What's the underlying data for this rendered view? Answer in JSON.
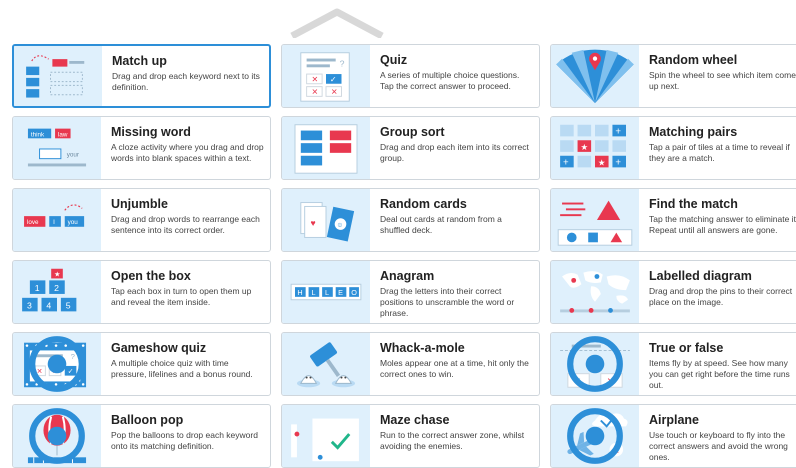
{
  "templates": [
    {
      "id": "match-up",
      "title": "Match up",
      "desc": "Drag and drop each keyword next to its definition.",
      "selected": true,
      "icon": "match-up-icon"
    },
    {
      "id": "quiz",
      "title": "Quiz",
      "desc": "A series of multiple choice questions. Tap the correct answer to proceed.",
      "icon": "quiz-icon"
    },
    {
      "id": "random-wheel",
      "title": "Random wheel",
      "desc": "Spin the wheel to see which item comes up next.",
      "icon": "wheel-icon"
    },
    {
      "id": "missing-word",
      "title": "Missing word",
      "desc": "A cloze activity where you drag and drop words into blank spaces within a text.",
      "icon": "missing-word-icon",
      "chips": [
        "think",
        "law",
        "your"
      ]
    },
    {
      "id": "group-sort",
      "title": "Group sort",
      "desc": "Drag and drop each item into its correct group.",
      "icon": "group-sort-icon"
    },
    {
      "id": "matching-pairs",
      "title": "Matching pairs",
      "desc": "Tap a pair of tiles at a time to reveal if they are a match.",
      "icon": "matching-pairs-icon"
    },
    {
      "id": "unjumble",
      "title": "Unjumble",
      "desc": "Drag and drop words to rearrange each sentence into its correct order.",
      "icon": "unjumble-icon",
      "chips": [
        "love",
        "I",
        "you"
      ]
    },
    {
      "id": "random-cards",
      "title": "Random cards",
      "desc": "Deal out cards at random from a shuffled deck.",
      "icon": "cards-icon"
    },
    {
      "id": "find-the-match",
      "title": "Find the match",
      "desc": "Tap the matching answer to eliminate it. Repeat until all answers are gone.",
      "icon": "find-match-icon"
    },
    {
      "id": "open-the-box",
      "title": "Open the box",
      "desc": "Tap each box in turn to open them up and reveal the item inside.",
      "icon": "boxes-icon",
      "chips": [
        "1",
        "2",
        "3",
        "4",
        "5"
      ]
    },
    {
      "id": "anagram",
      "title": "Anagram",
      "desc": "Drag the letters into their correct positions to unscramble the word or phrase.",
      "icon": "anagram-icon",
      "chips": [
        "H",
        "L",
        "L",
        "E",
        "O"
      ]
    },
    {
      "id": "labelled-diagram",
      "title": "Labelled diagram",
      "desc": "Drag and drop the pins to their correct place on the image.",
      "icon": "map-pins-icon"
    },
    {
      "id": "gameshow-quiz",
      "title": "Gameshow quiz",
      "desc": "A multiple choice quiz with time pressure, lifelines and a bonus round.",
      "icon": "gameshow-icon",
      "pro": true
    },
    {
      "id": "whack-a-mole",
      "title": "Whack-a-mole",
      "desc": "Moles appear one at a time, hit only the correct ones to win.",
      "icon": "mole-hammer-icon"
    },
    {
      "id": "true-or-false",
      "title": "True or false",
      "desc": "Items fly by at speed. See how many you can get right before the time runs out.",
      "icon": "true-false-icon",
      "pro": true
    },
    {
      "id": "balloon-pop",
      "title": "Balloon pop",
      "desc": "Pop the balloons to drop each keyword onto its matching definition.",
      "icon": "balloon-icon",
      "pro": true
    },
    {
      "id": "maze-chase",
      "title": "Maze chase",
      "desc": "Run to the correct answer zone, whilst avoiding the enemies.",
      "icon": "maze-icon"
    },
    {
      "id": "airplane",
      "title": "Airplane",
      "desc": "Use touch or keyboard to fly into the correct answers and avoid the wrong ones.",
      "icon": "airplane-icon",
      "pro": true
    }
  ],
  "colors": {
    "accent": "#2d8fd8",
    "red": "#e8384f",
    "thumb_bg": "#dff0fc"
  }
}
